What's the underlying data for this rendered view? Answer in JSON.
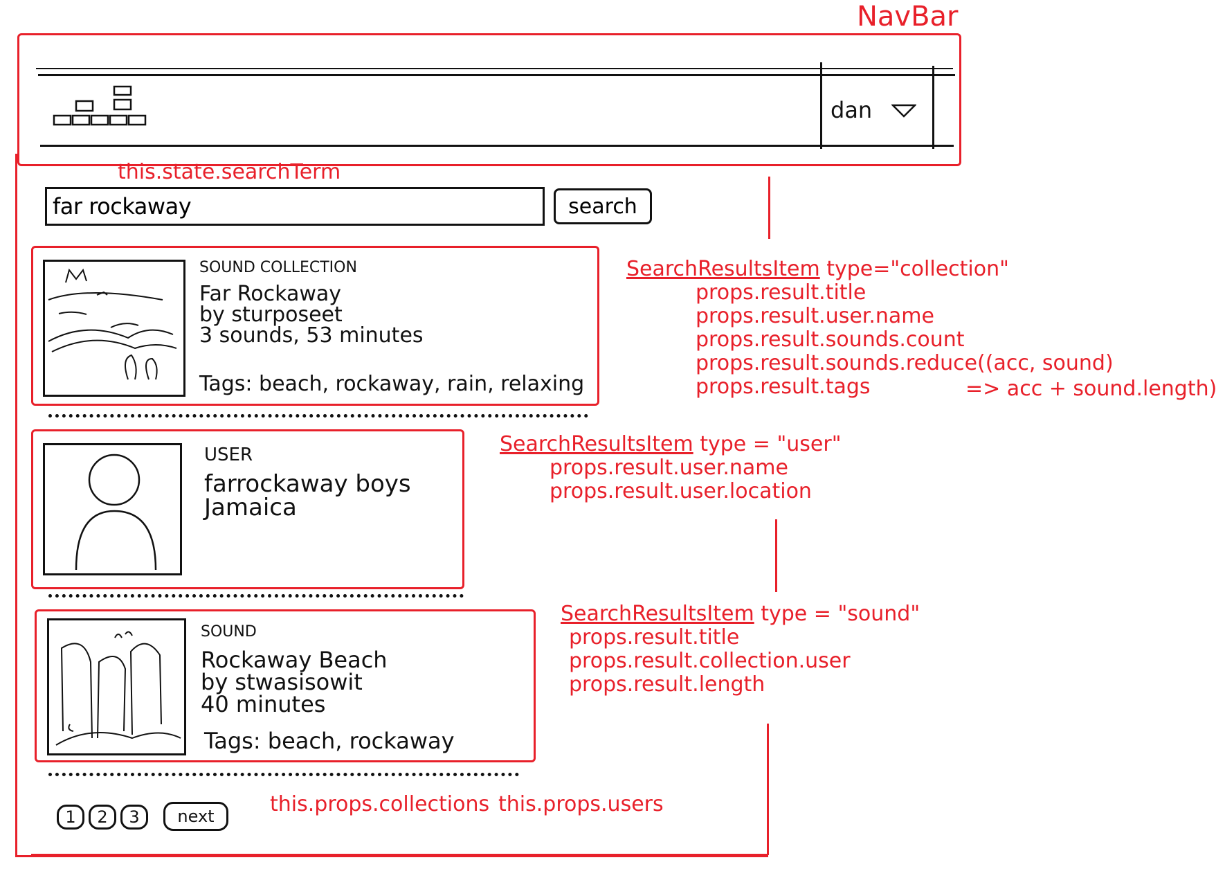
{
  "navbar_label": "NavBar",
  "navbar": {
    "user_menu": {
      "label": "dan",
      "icon": "chevron-down-icon"
    },
    "logo_icon": "stacked-blocks-logo"
  },
  "search": {
    "state_label": "this.state.searchTerm",
    "input_value": "far rockaway",
    "button_label": "search"
  },
  "results": [
    {
      "kind": "SOUND COLLECTION",
      "title": "Far Rockaway",
      "byline": "by sturposeet",
      "meta": "3 sounds, 53 minutes",
      "tags": "Tags: beach, rockaway, rain, relaxing",
      "thumbnail_icon": "landscape-sketch"
    },
    {
      "kind": "USER",
      "name": "farrockaway boys",
      "location": "Jamaica",
      "thumbnail_icon": "avatar-silhouette"
    },
    {
      "kind": "SOUND",
      "title": "Rockaway Beach",
      "byline": "by stwasisowit",
      "meta": "40 minutes",
      "tags": "Tags: beach, rockaway",
      "thumbnail_icon": "waterfall-sketch"
    }
  ],
  "annotations": {
    "collection": {
      "head": "SearchResultsItem",
      "type": "type=\"collection\"",
      "lines": [
        "props.result.title",
        "props.result.user.name",
        "props.result.sounds.count",
        "props.result.sounds.reduce((acc, sound)",
        "props.result.tags"
      ],
      "tail": "=> acc + sound.length)"
    },
    "user": {
      "head": "SearchResultsItem",
      "type": "type = \"user\"",
      "lines": [
        "props.result.user.name",
        "props.result.user.location"
      ]
    },
    "sound": {
      "head": "SearchResultsItem",
      "type": "type = \"sound\"",
      "lines": [
        "props.result.title",
        "props.result.collection.user",
        "props.result.length"
      ]
    },
    "footer": [
      "this.props.collections",
      "this.props.users"
    ]
  },
  "pagination": {
    "pages": [
      "1",
      "2",
      "3"
    ],
    "next_label": "next"
  },
  "colors": {
    "ink": "#111111",
    "annotation": "#e8202a"
  }
}
